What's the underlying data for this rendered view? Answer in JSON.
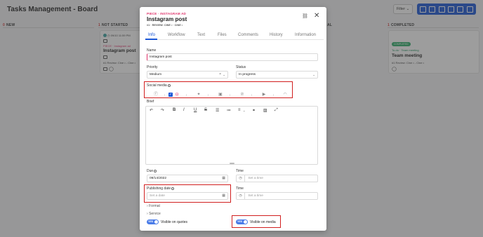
{
  "board": {
    "title": "Tasks Management - Board",
    "filter_label": "Filter ⌄",
    "columns": [
      {
        "count": "0",
        "name": "NEW"
      },
      {
        "count": "1",
        "name": "NOT STARTED"
      },
      {
        "name": "AL"
      },
      {
        "count": "1",
        "name": "COMPLETED"
      }
    ],
    "card_left": {
      "date": "09/10 11:59 PM",
      "path": "PIECE · Instagram ad",
      "title": "Instagram post",
      "review": "#1 Review: Cine • - Cine •"
    },
    "card_right": {
      "badge": "COMPLETED",
      "path": "To-do · Team meeting",
      "title": "Team meeting",
      "review": "#1 Review: Cine • - Cine •"
    }
  },
  "modal": {
    "path": "PIECE · INSTAGRAM AD",
    "title": "Instagram post",
    "subtitle": "#1 · REVIEW: CINE • · CINE •",
    "tabs": [
      "Info",
      "Workflow",
      "Text",
      "Files",
      "Comments",
      "History",
      "Information"
    ],
    "name_label": "Name",
    "name_value": "Instagram post",
    "priority_label": "Priority",
    "priority_value": "Medium",
    "status_label": "Status",
    "status_value": "In progress",
    "social_label": "Social media",
    "brief_label": "Brief",
    "due_label": "Due",
    "due_value": "09/14/2022",
    "time_label": "Time",
    "time_placeholder": "Set a time",
    "publishing_label": "Publishing date",
    "publishing_placeholder": "Set a date",
    "time2_label": "Time",
    "time2_placeholder": "Set a time",
    "format_label": "Format",
    "service_label": "Service",
    "toggle_yes": "YES",
    "visible_quotes": "Visible on quotes",
    "visible_media": "Visible on media"
  },
  "colors": {
    "accent": "#1a56d6",
    "pink": "#e0336b",
    "highlight": "#d11f1f",
    "toggle": "#4a7ce8"
  }
}
